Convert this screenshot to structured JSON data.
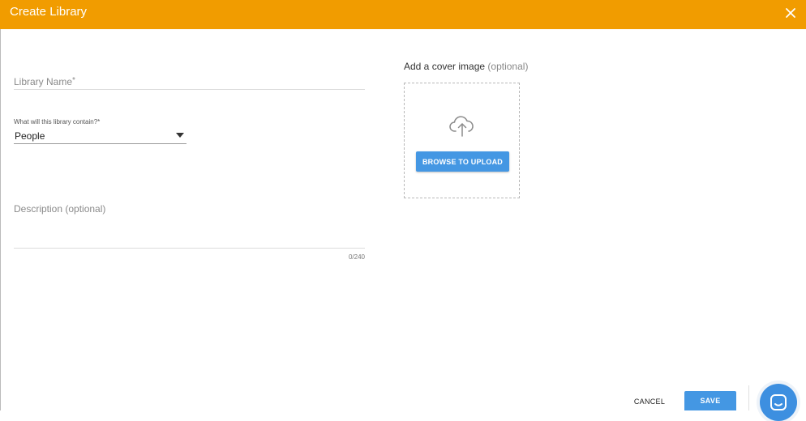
{
  "dialog": {
    "title": "Create Library",
    "header_color": "#f19c00",
    "close_icon": "close-icon"
  },
  "form": {
    "library_name": {
      "label": "Library Name",
      "required_mark": "*",
      "value": ""
    },
    "contains_select": {
      "label": "What will this library contain?",
      "required_mark": "*",
      "selected": "People",
      "icon": "caret-down-icon"
    },
    "description": {
      "label": "Description (optional)",
      "value": "",
      "counter": "0/240"
    }
  },
  "cover": {
    "title": "Add a cover image",
    "optional": "(optional)",
    "icon": "cloud-upload-icon",
    "browse_label": "BROWSE TO UPLOAD"
  },
  "footer": {
    "cancel_label": "CANCEL",
    "save_label": "SAVE",
    "accent_color": "#4497e3",
    "chat_icon": "chat-launcher-icon"
  }
}
